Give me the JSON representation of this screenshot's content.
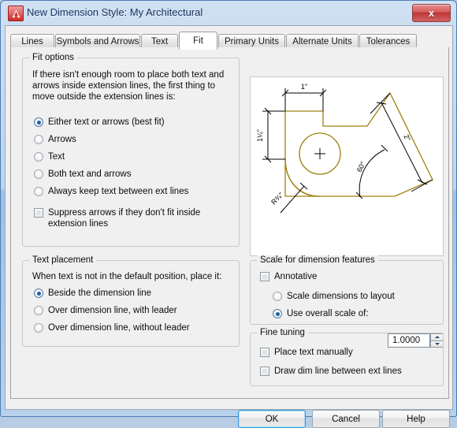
{
  "window": {
    "title": "New Dimension Style: My Architectural",
    "app_icon": "autocad-logo-icon",
    "close_label": "x"
  },
  "tabs": [
    {
      "label": "Lines",
      "active": false
    },
    {
      "label": "Symbols and Arrows",
      "active": false
    },
    {
      "label": "Text",
      "active": false
    },
    {
      "label": "Fit",
      "active": true
    },
    {
      "label": "Primary Units",
      "active": false
    },
    {
      "label": "Alternate Units",
      "active": false
    },
    {
      "label": "Tolerances",
      "active": false
    }
  ],
  "fit_options": {
    "legend": "Fit options",
    "description": "If there isn't enough room to place both text and arrows inside extension lines, the first thing to move outside the extension lines is:",
    "radios": [
      {
        "label": "Either text or arrows (best fit)",
        "checked": true
      },
      {
        "label": "Arrows",
        "checked": false
      },
      {
        "label": "Text",
        "checked": false
      },
      {
        "label": "Both text and arrows",
        "checked": false
      },
      {
        "label": "Always keep text between ext lines",
        "checked": false
      }
    ],
    "suppress_checkbox": {
      "label": "Suppress arrows if they don't fit inside extension lines",
      "checked": false
    }
  },
  "text_placement": {
    "legend": "Text placement",
    "description": "When text is not in the default position, place it:",
    "radios": [
      {
        "label": "Beside the dimension line",
        "checked": true
      },
      {
        "label": "Over dimension line, with leader",
        "checked": false
      },
      {
        "label": "Over dimension line, without leader",
        "checked": false
      }
    ]
  },
  "scale_features": {
    "legend": "Scale for dimension features",
    "annotative": {
      "label": "Annotative",
      "checked": false
    },
    "radios": [
      {
        "label": "Scale dimensions to layout",
        "checked": false
      },
      {
        "label": "Use overall scale of:",
        "checked": true
      }
    ],
    "overall_scale_value": "1.0000",
    "spin_up_icon": "chevron-up-icon",
    "spin_down_icon": "chevron-down-icon"
  },
  "fine_tuning": {
    "legend": "Fine tuning",
    "checkboxes": [
      {
        "label": "Place text manually",
        "checked": false
      },
      {
        "label": "Draw dim line between ext lines",
        "checked": false
      }
    ]
  },
  "preview": {
    "name": "dimension-style-preview",
    "geometry_color": "#a08010",
    "dimension_color": "#000000",
    "labels": {
      "width": "1\"",
      "height": "1¼\"",
      "radius": "R¾\"",
      "angle": "60°",
      "length": "2\""
    }
  },
  "buttons": {
    "ok": "OK",
    "cancel": "Cancel",
    "help": "Help"
  }
}
